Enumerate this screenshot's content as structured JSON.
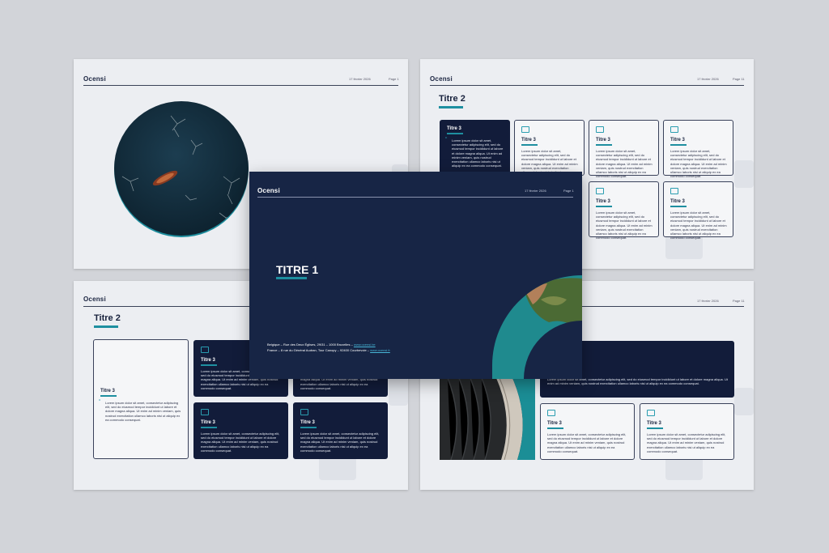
{
  "brand": "Ocensi",
  "date": "17 février 2026",
  "page_label": "Page 1",
  "page_label_alt": "Page 11",
  "main_slide": {
    "title": "TITRE 1",
    "address_be": "Belgique – Rue des Deux Églises, 29/31 – 1000 Bruxelles – ",
    "link_be": "www.ocensi.be",
    "address_fr": "France – 8 rue du Général Audran, Tour Canopy – 92400 Courbevoie – ",
    "link_fr": "www.ocensi.fr"
  },
  "heading2": "Titre 2",
  "card_title": "Titre 3",
  "lorem": "Lorem ipsum dolor sit amet, consectetur adipiscing elit, sed do eiusmod tempor incididunt ut labore et dolore magna aliqua. Ut enim ad minim veniam, quis nostrud exercitation ullamco laboris nisi ut aliquip ex ea commodo consequat.",
  "lorem_wide": "Lorem ipsum dolor sit amet, consectetur adipiscing elit, sed do eiusmod tempor incididunt ut labore et dolore magna aliqua. Ut enim ad minim veniam, quis nostrud exercitation ullamco laboris nisi ut aliquip ex ea commodo consequat.",
  "colors": {
    "navy": "#172545",
    "teal": "#1e8fa0",
    "background": "#d2d4d9",
    "slide": "#eceef2"
  },
  "icons": [
    "briefcase-icon",
    "quote-icon"
  ]
}
